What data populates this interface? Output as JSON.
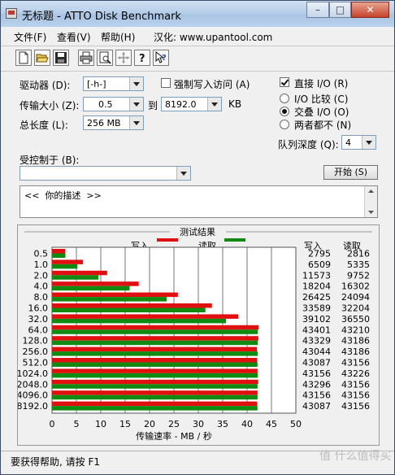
{
  "window": {
    "title": "无标题 - ATTO Disk Benchmark",
    "min_label": "–",
    "max_label": "□",
    "close_label": "✕"
  },
  "menu": {
    "file": "文件(F)",
    "view": "查看(V)",
    "help": "帮助(H)",
    "localization": "汉化: www.upantool.com"
  },
  "toolbar": [
    "new-doc-icon",
    "open-folder-icon",
    "save-icon",
    "print-icon",
    "print-preview-icon",
    "move-icon",
    "help-icon",
    "context-help-icon"
  ],
  "form": {
    "drive_label": "驱动器 (D):",
    "drive_value": "[-h-]",
    "force_write_label": "强制写入访问 (A)",
    "force_write_checked": false,
    "direct_io_label": "直接 I/O (R)",
    "direct_io_checked": true,
    "transfer_label": "传输大小 (Z):",
    "transfer_from": "0.5",
    "to_label": "到",
    "transfer_to": "8192.0",
    "kb_label": "KB",
    "total_label": "总长度 (L):",
    "total_value": "256 MB",
    "io_compare_label": "I/O 比较 (C)",
    "overlap_io_label": "交叠 I/O (O)",
    "neither_label": "两者都不 (N)",
    "selected_mode": "overlap",
    "queue_label": "队列深度 (Q):",
    "queue_value": "4",
    "controlled_label": "受控制于 (B):",
    "controlled_value": "",
    "start_button": "开始 (S)",
    "description": "<<  你的描述  >>"
  },
  "results": {
    "group_title": "测试结果",
    "legend_write": "写入",
    "legend_read": "读取",
    "col_write": "写入",
    "col_read": "读取",
    "colors": {
      "write": "#e01010",
      "read": "#118a11"
    }
  },
  "chart_data": {
    "type": "bar",
    "orientation": "horizontal",
    "xlabel": "传输速率 - MB / 秒",
    "xlim": [
      0,
      50
    ],
    "xticks": [
      "0",
      "5",
      "10",
      "15",
      "20",
      "25",
      "30",
      "35",
      "40",
      "45",
      "50"
    ],
    "categories": [
      "0.5",
      "1.0",
      "2.0",
      "4.0",
      "8.0",
      "16.0",
      "32.0",
      "64.0",
      "128.0",
      "256.0",
      "512.0",
      "1024.0",
      "2048.0",
      "4096.0",
      "8192.0"
    ],
    "series": [
      {
        "name": "写入",
        "values": [
          2.73,
          6.36,
          11.3,
          17.78,
          25.81,
          32.79,
          38.19,
          42.38,
          42.31,
          42.03,
          42.08,
          42.14,
          42.28,
          42.14,
          42.08
        ]
      },
      {
        "name": "读取",
        "values": [
          2.75,
          5.21,
          9.52,
          15.92,
          23.53,
          31.45,
          35.69,
          42.2,
          42.17,
          42.17,
          42.14,
          42.21,
          42.14,
          42.14,
          42.14
        ]
      }
    ],
    "write_kbps": [
      "2795",
      "6509",
      "11573",
      "18204",
      "26425",
      "33589",
      "39102",
      "43401",
      "43329",
      "43044",
      "43087",
      "43156",
      "43296",
      "43156",
      "43087"
    ],
    "read_kbps": [
      "2816",
      "5335",
      "9752",
      "16302",
      "24094",
      "32204",
      "36550",
      "43210",
      "43186",
      "43186",
      "43156",
      "43226",
      "43156",
      "43156",
      "43156"
    ]
  },
  "status": {
    "text": "要获得帮助, 请按 F1"
  },
  "watermark": "值 什么值得买"
}
